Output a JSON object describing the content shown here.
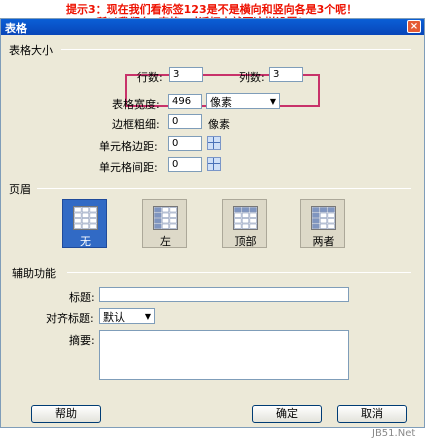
{
  "annotation": {
    "line1": "提示3：现在我们看标签123是不是横向和竖向各是3个呢！",
    "line2": "所以我们在“表格”对话框内就要这样设置！"
  },
  "window": {
    "title": "表格",
    "close": "×"
  },
  "table_size": {
    "section": "表格大小",
    "rows_label": "行数:",
    "rows_value": "3",
    "cols_label": "列数:",
    "cols_value": "3",
    "width_label": "表格宽度:",
    "width_value": "496",
    "width_unit": "像素",
    "border_label": "边框粗细:",
    "border_value": "0",
    "border_unit": "像素",
    "padding_label": "单元格边距:",
    "padding_value": "0",
    "spacing_label": "单元格间距:",
    "spacing_value": "0"
  },
  "header": {
    "section": "页眉",
    "options": [
      {
        "label": "无",
        "selected": true
      },
      {
        "label": "左",
        "selected": false
      },
      {
        "label": "顶部",
        "selected": false
      },
      {
        "label": "两者",
        "selected": false
      }
    ]
  },
  "accessibility": {
    "section": "辅助功能",
    "caption_label": "标题:",
    "caption_value": "",
    "align_label": "对齐标题:",
    "align_value": "默认",
    "summary_label": "摘要:",
    "summary_value": ""
  },
  "footer": {
    "help": "帮助",
    "ok": "确定",
    "cancel": "取消"
  },
  "watermark": "JB51.Net"
}
